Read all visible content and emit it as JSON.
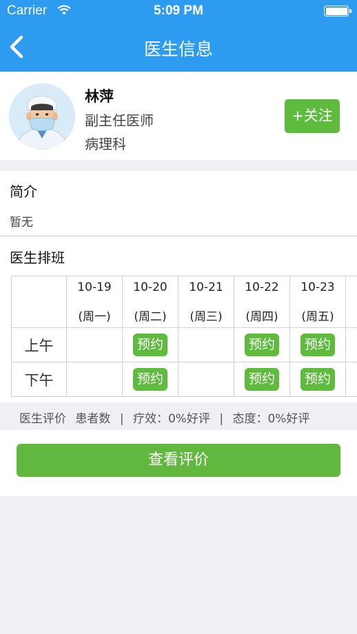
{
  "status_bar": {
    "carrier": "Carrier",
    "time": "5:09 PM",
    "icons": [
      "wifi-icon",
      "battery-icon"
    ]
  },
  "nav": {
    "title": "医生信息",
    "back_icon": "chevron-left-icon"
  },
  "doctor": {
    "name": "林萍",
    "title": "副主任医师",
    "department": "病理科",
    "follow_label": "+关注",
    "avatar_icon": "doctor-avatar-icon"
  },
  "intro": {
    "heading": "简介",
    "text": "暂无"
  },
  "schedule": {
    "heading": "医生排班",
    "columns": [
      {
        "date": "10-19",
        "weekday": "(周一)"
      },
      {
        "date": "10-20",
        "weekday": "(周二)"
      },
      {
        "date": "10-21",
        "weekday": "(周三)"
      },
      {
        "date": "10-22",
        "weekday": "(周四)"
      },
      {
        "date": "10-23",
        "weekday": "(周五)"
      }
    ],
    "rows": [
      {
        "period": "上午",
        "slots": [
          "",
          "预约",
          "",
          "预约",
          "预约"
        ]
      },
      {
        "period": "下午",
        "slots": [
          "",
          "预约",
          "",
          "预约",
          "预约"
        ]
      }
    ]
  },
  "rating": {
    "label": "医生评价",
    "patients": "患者数",
    "sep1": "|",
    "efficacy": "疗效：0%好评",
    "sep2": "|",
    "attitude": "态度：0%好评"
  },
  "view_reviews_label": "查看评价",
  "colors": {
    "nav_blue": "#2d9cf0",
    "accent_green": "#5fbb3d",
    "background": "#efeff4"
  }
}
